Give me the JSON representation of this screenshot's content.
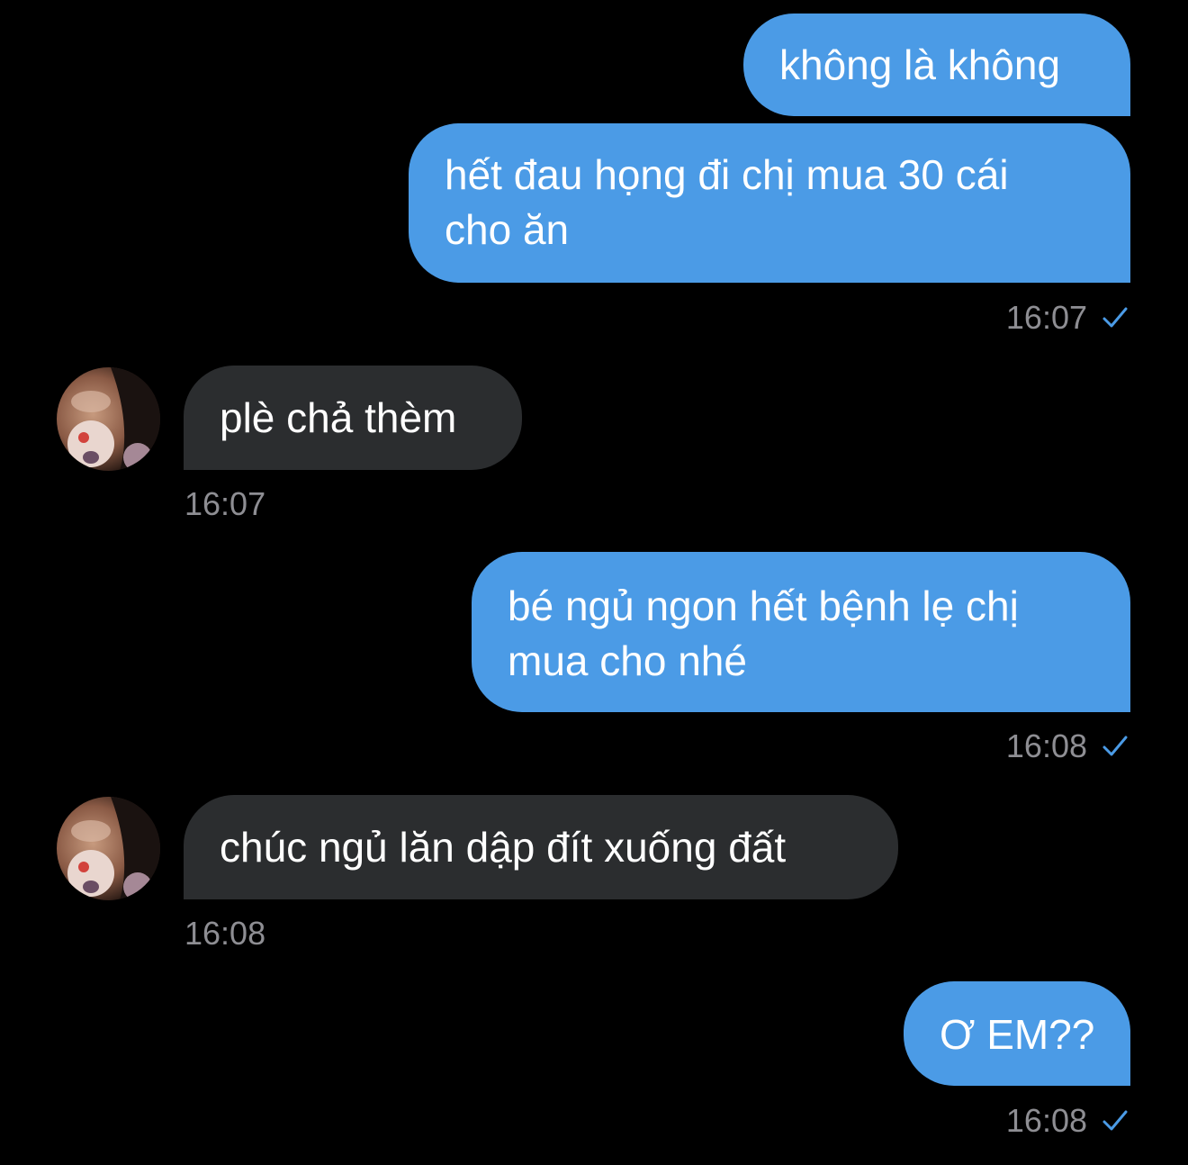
{
  "conversation": {
    "messages": [
      {
        "direction": "outgoing",
        "text": "không là không"
      },
      {
        "direction": "outgoing",
        "text_line1": "hết đau họng đi chị mua 30 cái",
        "text_line2": "cho ăn",
        "time": "16:07",
        "status": "read-check"
      },
      {
        "direction": "incoming",
        "text": "plè chả thèm",
        "time": "16:07"
      },
      {
        "direction": "outgoing",
        "text_line1": "bé ngủ ngon hết bệnh lẹ chị",
        "text_line2": "mua cho nhé",
        "time": "16:08",
        "status": "read-check"
      },
      {
        "direction": "incoming",
        "text": "chúc ngủ lăn dập đít xuống đất",
        "time": "16:08"
      },
      {
        "direction": "outgoing",
        "text": "Ơ EM??",
        "time": "16:08",
        "status": "read-check"
      }
    ]
  },
  "colors": {
    "background": "#000000",
    "outgoing_bubble": "#4b9be6",
    "incoming_bubble": "#2b2d2f",
    "timestamp": "#8e8e93",
    "check": "#4b9be6"
  },
  "icons": {
    "status": "check-icon",
    "avatar": "contact-avatar-photo"
  }
}
